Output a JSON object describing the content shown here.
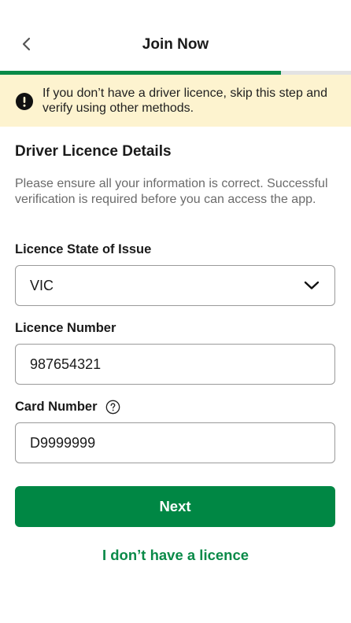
{
  "header": {
    "title": "Join Now",
    "back_icon": "chevron-left-icon",
    "progress_percent": 80,
    "progress_color": "#0a8a48"
  },
  "alert": {
    "icon": "exclamation-circle-icon",
    "text": "If you don’t have a driver licence, skip this step and verify using other methods.",
    "background": "#fdf3cf"
  },
  "section": {
    "title": "Driver Licence Details",
    "subtitle": "Please ensure all your information is correct. Successful verification is required before you can access the app."
  },
  "form": {
    "state": {
      "label": "Licence State of Issue",
      "value": "VIC",
      "icon": "chevron-down-icon"
    },
    "licence_number": {
      "label": "Licence Number",
      "value": "987654321"
    },
    "card_number": {
      "label": "Card Number",
      "value": "D9999999",
      "help_icon": "question-circle-icon"
    }
  },
  "actions": {
    "next_label": "Next",
    "no_licence_label": "I don’t have a licence",
    "primary_color": "#008744"
  }
}
